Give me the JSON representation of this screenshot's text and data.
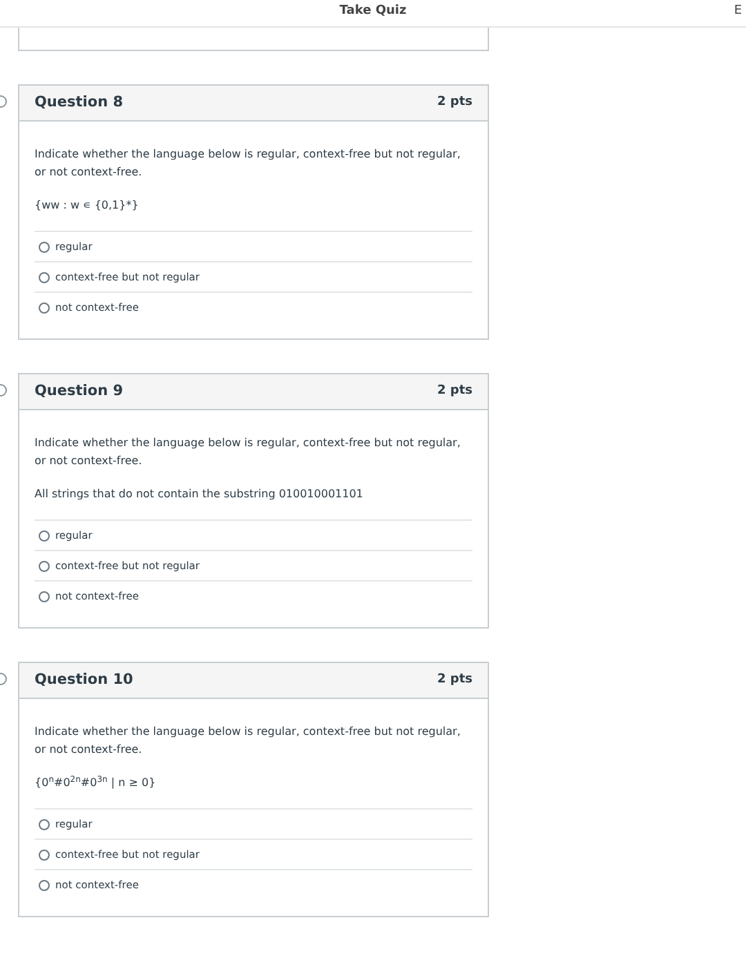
{
  "header": {
    "title": "Take Quiz",
    "right_text": "E"
  },
  "questions": [
    {
      "title": "Question 8",
      "points": "2 pts",
      "prompt": "Indicate whether the language below is regular, context-free but not regular, or not context-free.",
      "expression": "{ww : w ∊ {0,1}*}",
      "answers": [
        {
          "label": "regular",
          "selected": false
        },
        {
          "label": "context-free but not regular",
          "selected": false
        },
        {
          "label": "not context-free",
          "selected": false
        }
      ]
    },
    {
      "title": "Question 9",
      "points": "2 pts",
      "prompt": "Indicate whether the language below is regular, context-free but not regular, or not context-free.",
      "expression": "All strings that do not contain the substring 010010001101",
      "answers": [
        {
          "label": "regular",
          "selected": false
        },
        {
          "label": "context-free but not regular",
          "selected": false
        },
        {
          "label": "not context-free",
          "selected": false
        }
      ]
    },
    {
      "title": "Question 10",
      "points": "2 pts",
      "prompt": "Indicate whether the language below is regular, context-free but not regular, or not context-free.",
      "expression": "{0$^{n}$#0$^{2n}$#0$^{3n}$ | n ≥ 0}",
      "answers": [
        {
          "label": "regular",
          "selected": false
        },
        {
          "label": "context-free but not regular",
          "selected": false
        },
        {
          "label": "not context-free",
          "selected": false
        }
      ]
    }
  ]
}
